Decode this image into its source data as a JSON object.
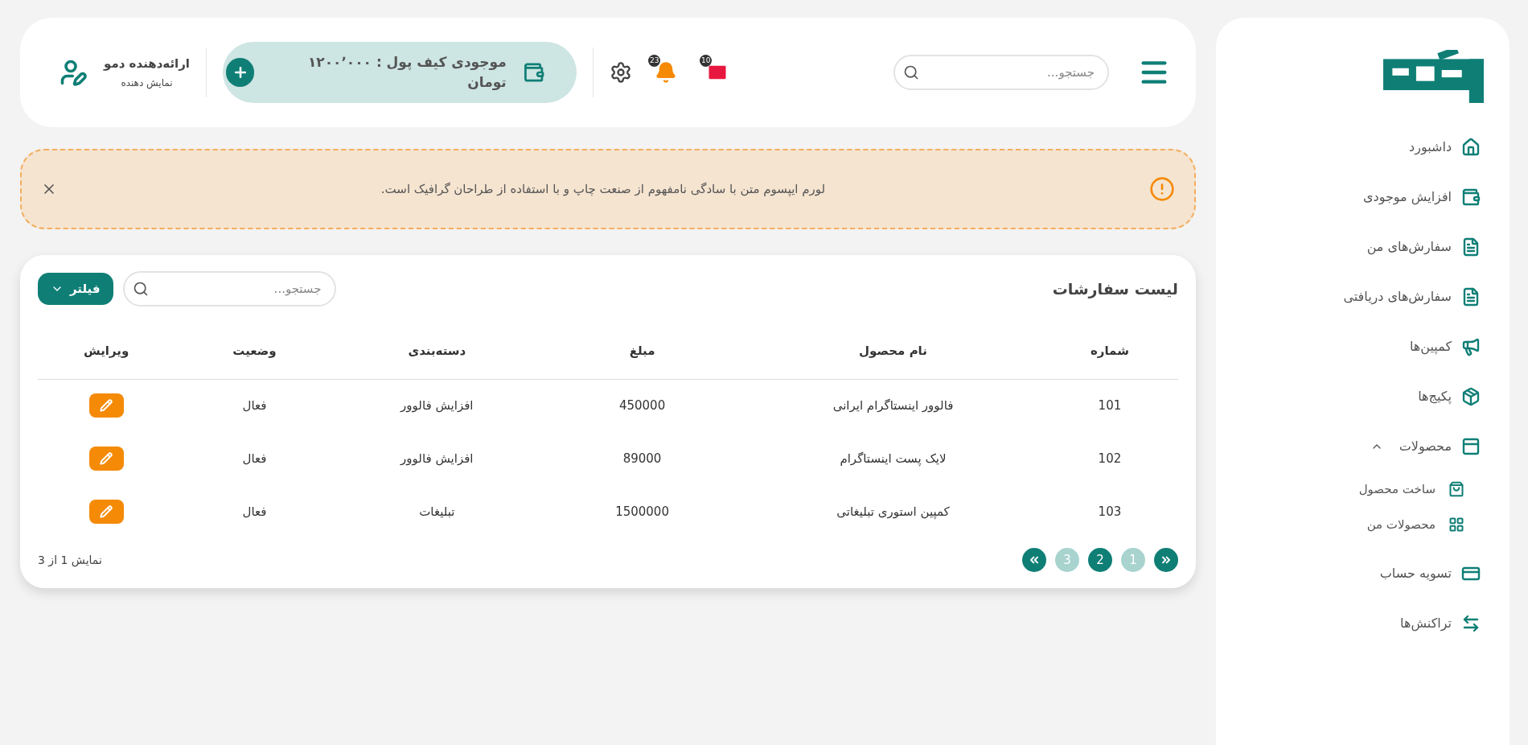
{
  "sidebar": {
    "items": [
      {
        "label": "داشبورد",
        "kind": "link"
      },
      {
        "label": "افزایش موجودی",
        "kind": "link"
      },
      {
        "label": "سفارش‌های من",
        "kind": "link"
      },
      {
        "label": "سفارش‌های دریافتی",
        "kind": "link"
      },
      {
        "label": "کمپین‌ها",
        "kind": "link"
      },
      {
        "label": "پکیج‌ها",
        "kind": "link"
      },
      {
        "label": "محصولات",
        "kind": "group",
        "expanded": true,
        "children": [
          {
            "label": "ساخت محصول"
          },
          {
            "label": "محصولات من"
          }
        ]
      },
      {
        "label": "تسویه حساب",
        "kind": "link"
      },
      {
        "label": "تراکنش‌ها",
        "kind": "link"
      }
    ]
  },
  "header": {
    "search": {
      "placeholder": "جستجو..."
    },
    "mail_badge": "10",
    "bell_badge": "23",
    "wallet": {
      "label": "موجودی کیف پول : ۱۲۰۰٬۰۰۰ تومان"
    },
    "user": {
      "name": "ارائه‌دهنده دمو",
      "role": "نمایش دهنده"
    }
  },
  "alert": {
    "text": "لورم ایپسوم متن با سادگی نامفهوم از صنعت چاپ و با استفاده از طراحان گرافیک است."
  },
  "orders": {
    "title": "لیست سفارشات",
    "search": {
      "placeholder": "جستجو..."
    },
    "filter": "فیلتر",
    "columns": [
      "شماره",
      "نام محصول",
      "مبلغ",
      "دسته‌بندی",
      "وضعیت",
      "ویرایش"
    ],
    "rows": [
      {
        "number": "101",
        "product": "فالوور اینستاگرام ایرانی",
        "amount": "450000",
        "category": "افزایش فالوور",
        "status": "فعال"
      },
      {
        "number": "102",
        "product": "لایک پست اینستاگرام",
        "amount": "89000",
        "category": "افزایش فالوور",
        "status": "فعال"
      },
      {
        "number": "103",
        "product": "کمپین استوری تبلیغاتی",
        "amount": "1500000",
        "category": "تبلیغات",
        "status": "فعال"
      }
    ],
    "footer": "نمایش 1 از 3",
    "pages": [
      {
        "label": "1",
        "selected": false
      },
      {
        "label": "2",
        "selected": true
      },
      {
        "label": "3",
        "selected": false
      }
    ]
  }
}
